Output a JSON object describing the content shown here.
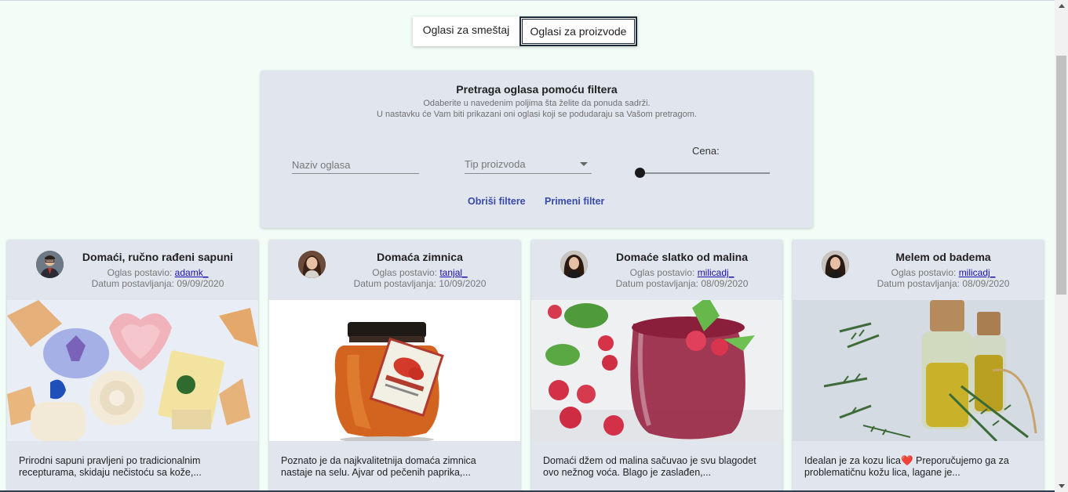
{
  "tabs": {
    "accommodation": "Oglasi za smeštaj",
    "products": "Oglasi za proizvode"
  },
  "filter": {
    "title": "Pretraga oglasa pomoću filtera",
    "subtitle_1": "Odaberite u navedenim poljima šta želite da ponuda sadrži.",
    "subtitle_2": "U nastavku će Vam biti prikazani oni oglasi koji se podudaraju sa Vašom pretragom.",
    "name_placeholder": "Naziv oglasa",
    "type_placeholder": "Tip proizvoda",
    "price_label": "Cena:",
    "price_slider_value": 0,
    "clear_button": "Obriši filtere",
    "apply_button": "Primeni filter"
  },
  "cards": [
    {
      "title": "Domaći, ručno rađeni sapuni",
      "posted_by_label": "Oglas postavio:",
      "posted_by": "adamk_",
      "date_label": "Datum postavljanja:",
      "date": "09/09/2020",
      "description": "Prirodni sapuni pravljeni po tradicionalnim recepturama, skidaju nečistoću sa kože,..."
    },
    {
      "title": "Domaća zimnica",
      "posted_by_label": "Oglas postavio:",
      "posted_by": "tanjal_",
      "date_label": "Datum postavljanja:",
      "date": "10/09/2020",
      "description": "Poznato je da najkvalitetnija domaća zimnica nastaje na selu. Ajvar od pečenih paprika,..."
    },
    {
      "title": "Domaće slatko od malina",
      "posted_by_label": "Oglas postavio:",
      "posted_by": "milicadj_",
      "date_label": "Datum postavljanja:",
      "date": "08/09/2020",
      "description": "Domaći džem od malina sačuvao je svu blagodet ovo nežnog voća. Blago je zaslađen,..."
    },
    {
      "title": "Melem od badema",
      "posted_by_label": "Oglas postavio:",
      "posted_by": "milicadj_",
      "date_label": "Datum postavljanja:",
      "date": "08/09/2020",
      "description": "Idealan je za kozu lica❤️ Preporučujemo ga za problematičnu kožu lica, lagane je..."
    }
  ]
}
